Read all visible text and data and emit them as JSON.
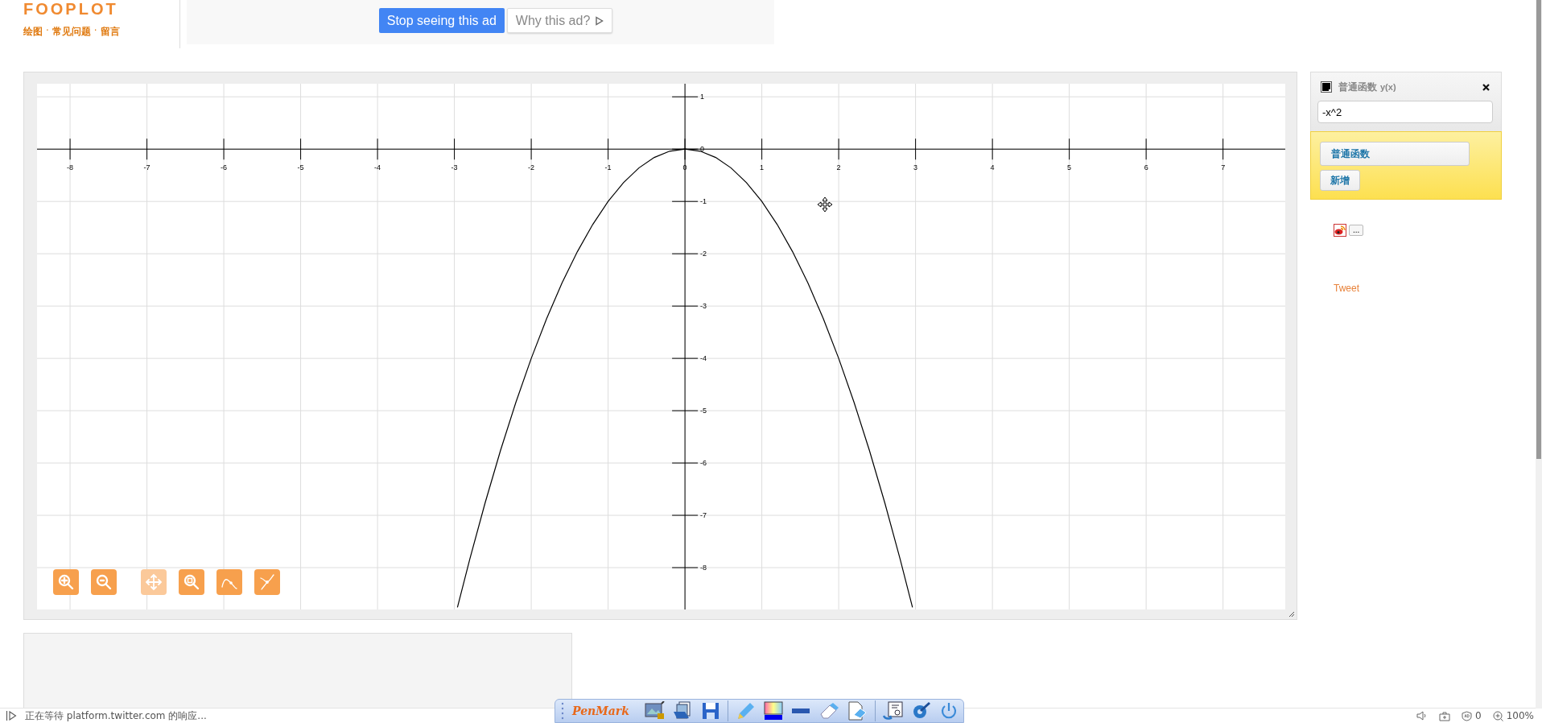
{
  "header": {
    "logo": "FOOPLOT",
    "nav": [
      {
        "kind": "link",
        "label": "绘图"
      },
      {
        "kind": "separator",
        "label": "·"
      },
      {
        "kind": "link",
        "label": "常见问题"
      },
      {
        "kind": "separator",
        "label": "·"
      },
      {
        "kind": "link",
        "label": "留言"
      }
    ]
  },
  "ad": {
    "buttons": [
      {
        "kind": "primary",
        "label": "Stop seeing this ad"
      },
      {
        "kind": "secondary",
        "label": "Why this ad?"
      }
    ]
  },
  "plot": {
    "chart_data": {
      "type": "line",
      "xlim": [
        -8.43,
        7.81
      ],
      "ylim": [
        -8.8,
        1.25
      ],
      "xticks": [
        -8,
        -7,
        -6,
        -5,
        -4,
        -3,
        -2,
        -1,
        0,
        1,
        2,
        3,
        4,
        5,
        6,
        7
      ],
      "yticks": [
        -8,
        -7,
        -6,
        -5,
        -4,
        -3,
        -2,
        -1,
        0,
        1
      ],
      "grid": true,
      "x": [
        -2.96,
        -2.8,
        -2.6,
        -2.4,
        -2.2,
        -2,
        -1.8,
        -1.6,
        -1.4,
        -1.2,
        -1,
        -0.8,
        -0.6,
        -0.4,
        -0.2,
        0,
        0.2,
        0.4,
        0.6,
        0.8,
        1,
        1.2,
        1.4,
        1.6,
        1.8,
        2,
        2.2,
        2.4,
        2.6,
        2.8,
        2.96
      ],
      "series": [
        {
          "color": "#000000",
          "values": [
            -8.76,
            -7.84,
            -6.76,
            -5.76,
            -4.84,
            -4,
            -3.24,
            -2.56,
            -1.96,
            -1.44,
            -1,
            -0.64,
            -0.36,
            -0.16,
            -0.04,
            0,
            -0.04,
            -0.16,
            -0.36,
            -0.64,
            -1,
            -1.44,
            -1.96,
            -2.56,
            -3.24,
            -4,
            -4.84,
            -5.76,
            -6.76,
            -7.84,
            -8.76
          ]
        }
      ]
    },
    "tools": [
      {
        "kind": "zoom-in",
        "selected": false
      },
      {
        "kind": "zoom-out",
        "selected": false
      },
      {
        "kind": "pan",
        "selected": true
      },
      {
        "kind": "zoom-box",
        "selected": false
      },
      {
        "kind": "trace",
        "selected": false
      },
      {
        "kind": "intersect",
        "selected": false
      }
    ]
  },
  "function_panel": {
    "type_label": "普通函数",
    "variable_label": "y(x)",
    "expression": "-x^2",
    "type_button": "普通函数",
    "add_button": "新增"
  },
  "share": {
    "more_button": "...",
    "tweet": "Tweet"
  },
  "status_bar": {
    "message": "正在等待 platform.twitter.com 的响应...",
    "ad_count": "0",
    "zoom": "100%"
  },
  "penmark": {
    "logo": "PenMark"
  }
}
